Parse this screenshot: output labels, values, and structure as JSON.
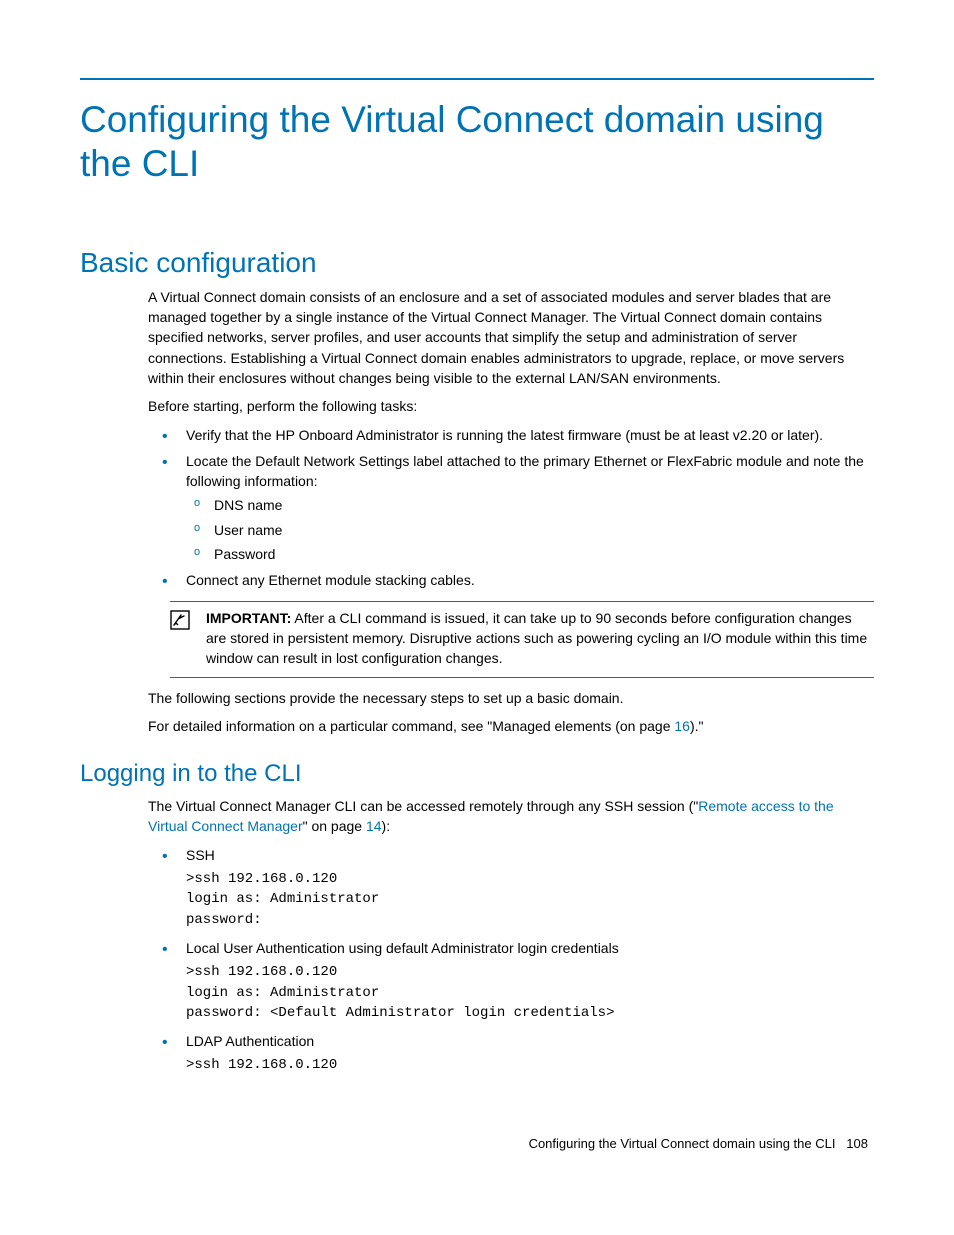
{
  "title": "Configuring the Virtual Connect domain using the CLI",
  "section1": "Basic configuration",
  "p1": "A Virtual Connect domain consists of an enclosure and a set of associated modules and server blades that are managed together by a single instance of the Virtual Connect Manager. The Virtual Connect domain contains specified networks, server profiles, and user accounts that simplify the setup and administration of server connections. Establishing a Virtual Connect domain enables administrators to upgrade, replace, or move servers within their enclosures without changes being visible to the external LAN/SAN environments.",
  "p2": "Before starting, perform the following tasks:",
  "b1": "Verify that the HP Onboard Administrator is running the latest firmware (must be at least v2.20 or later).",
  "b2": "Locate the Default Network Settings label attached to the primary Ethernet or FlexFabric module and note the following information:",
  "b2a": "DNS name",
  "b2b": "User name",
  "b2c": "Password",
  "b3": "Connect any Ethernet module stacking cables.",
  "imp_label": "IMPORTANT:",
  "imp_text": "   After a CLI command is issued, it can take up to 90 seconds before configuration changes are stored in persistent memory. Disruptive actions such as powering cycling an I/O module within this time window can result in lost configuration changes.",
  "p3": "The following sections provide the necessary steps to set up a basic domain.",
  "p4a": "For detailed information on a particular command, see \"Managed elements (on page ",
  "p4link": "16",
  "p4b": ").\"",
  "section2": "Logging in to the CLI",
  "p5a": "The Virtual Connect Manager CLI can be accessed remotely through any SSH session (\"",
  "p5link": "Remote access to the Virtual Connect Manager",
  "p5b": "\" on page ",
  "p5page": "14",
  "p5c": "):",
  "bb1": "SSH",
  "code1": ">ssh 192.168.0.120\nlogin as: Administrator\npassword:",
  "bb2": "Local User Authentication using default Administrator login credentials",
  "code2": ">ssh 192.168.0.120\nlogin as: Administrator\npassword: <Default Administrator login credentials>",
  "bb3": "LDAP Authentication",
  "code3": ">ssh 192.168.0.120",
  "footer_text": "Configuring the Virtual Connect domain using the CLI",
  "footer_page": "108"
}
